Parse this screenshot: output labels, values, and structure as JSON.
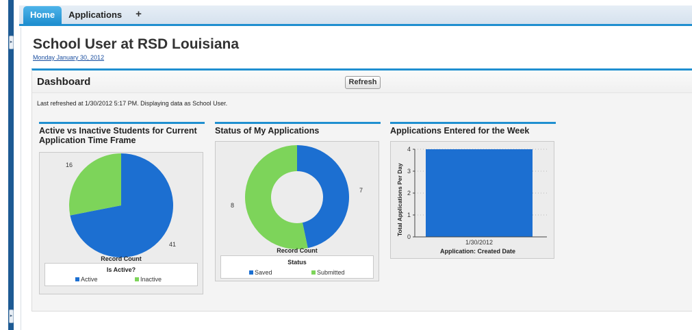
{
  "tabs": [
    {
      "label": "Home",
      "active": true
    },
    {
      "label": "Applications",
      "active": false
    },
    {
      "label": "+",
      "active": false
    }
  ],
  "page": {
    "title": "School User at RSD Louisiana",
    "date": "Monday January 30, 2012"
  },
  "dashboard": {
    "title": "Dashboard",
    "refresh_label": "Refresh",
    "status": "Last refreshed at 1/30/2012 5:17 PM. Displaying data as School User."
  },
  "colors": {
    "accent": "#1f8fd0",
    "series_blue": "#1c6fd1",
    "series_green": "#7dd45a"
  },
  "charts": {
    "active_inactive": {
      "title": "Active vs Inactive Students for Current Application Time Frame",
      "caption": "Record Count",
      "legend_title": "Is Active?",
      "legend_items": [
        "Active",
        "Inactive"
      ],
      "label_inactive": "16",
      "label_active": "41"
    },
    "status": {
      "title": "Status of My Applications",
      "caption": "Record Count",
      "legend_title": "Status",
      "legend_items": [
        "Saved",
        "Submitted"
      ],
      "label_saved": "7",
      "label_submitted": "8"
    },
    "week": {
      "title": "Applications Entered for the Week",
      "ylabel": "Total Applications Per Day",
      "xlabel": "Application: Created Date",
      "y_ticks": [
        "0",
        "1",
        "2",
        "3",
        "4"
      ],
      "category": "1/30/2012"
    }
  },
  "chart_data": [
    {
      "type": "pie",
      "title": "Active vs Inactive Students for Current Application Time Frame",
      "categories": [
        "Active",
        "Inactive"
      ],
      "values": [
        41,
        16
      ],
      "legend": "bottom"
    },
    {
      "type": "pie",
      "title": "Status of My Applications",
      "categories": [
        "Saved",
        "Submitted"
      ],
      "values": [
        7,
        8
      ],
      "donut": true,
      "legend": "bottom"
    },
    {
      "type": "bar",
      "title": "Applications Entered for the Week",
      "categories": [
        "1/30/2012"
      ],
      "values": [
        4
      ],
      "xlabel": "Application: Created Date",
      "ylabel": "Total Applications Per Day",
      "ylim": [
        0,
        4
      ]
    }
  ]
}
